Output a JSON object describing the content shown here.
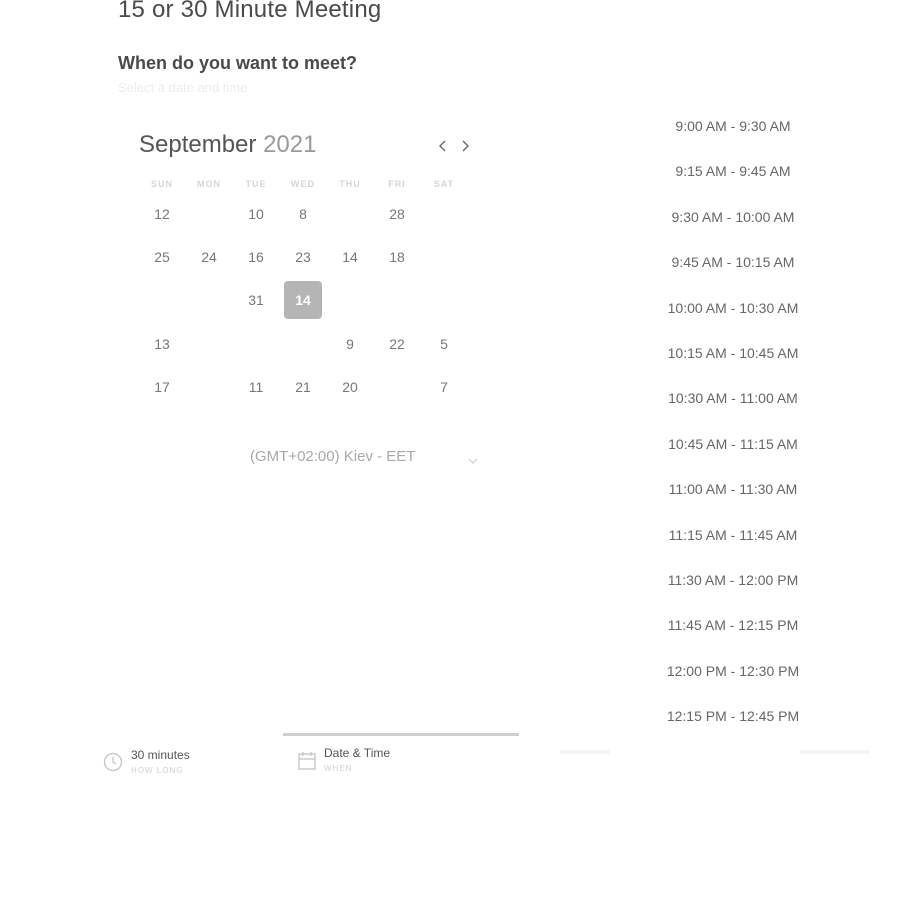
{
  "header": {
    "title": "15 or 30 Minute Meeting",
    "question": "When do you want to meet?",
    "hint": "Select a date and time"
  },
  "calendar": {
    "month": "September",
    "year": "2021",
    "weekdays": [
      "SUN",
      "MON",
      "TUE",
      "WED",
      "THU",
      "FRI",
      "SAT"
    ],
    "rows": [
      [
        {
          "t": "12"
        },
        {
          "t": ""
        },
        {
          "t": "10"
        },
        {
          "t": "8"
        },
        {
          "t": ""
        },
        {
          "t": "28"
        },
        {
          "t": ""
        }
      ],
      [
        {
          "t": "25"
        },
        {
          "t": "24"
        },
        {
          "t": "16"
        },
        {
          "t": "23"
        },
        {
          "t": "14"
        },
        {
          "t": "18"
        },
        {
          "t": ""
        }
      ],
      [
        {
          "t": ""
        },
        {
          "t": ""
        },
        {
          "t": "31"
        },
        {
          "t": "14",
          "selected": true
        },
        {
          "t": ""
        },
        {
          "t": ""
        },
        {
          "t": ""
        }
      ],
      [
        {
          "t": "13"
        },
        {
          "t": ""
        },
        {
          "t": ""
        },
        {
          "t": ""
        },
        {
          "t": "9"
        },
        {
          "t": "22"
        },
        {
          "t": "5"
        }
      ],
      [
        {
          "t": "17"
        },
        {
          "t": ""
        },
        {
          "t": "11"
        },
        {
          "t": "21"
        },
        {
          "t": "20"
        },
        {
          "t": ""
        },
        {
          "t": "7"
        }
      ]
    ]
  },
  "timezone": {
    "label": "(GMT+02:00) Kiev - EET"
  },
  "slots": [
    "9:00 AM - 9:30 AM",
    "9:15 AM - 9:45 AM",
    "9:30 AM - 10:00 AM",
    "9:45 AM - 10:15 AM",
    "10:00 AM - 10:30 AM",
    "10:15 AM - 10:45 AM",
    "10:30 AM - 11:00 AM",
    "10:45 AM - 11:15 AM",
    "11:00 AM - 11:30 AM",
    "11:15 AM - 11:45 AM",
    "11:30 AM - 12:00 PM",
    "11:45 AM - 12:15 PM",
    "12:00 PM - 12:30 PM",
    "12:15 PM - 12:45 PM"
  ],
  "steps": {
    "duration": {
      "label": "30 minutes",
      "sub": "HOW LONG"
    },
    "when": {
      "label": "Date & Time",
      "sub": "WHEN"
    }
  },
  "colors": {
    "selected_day": "#b5b5b5",
    "progress_line": "#cfcfcf"
  },
  "icons": {
    "prev": "chevron-left-icon",
    "next": "chevron-right-icon",
    "timezone": "chevron-down-icon",
    "duration": "clock-icon",
    "when": "calendar-icon"
  }
}
